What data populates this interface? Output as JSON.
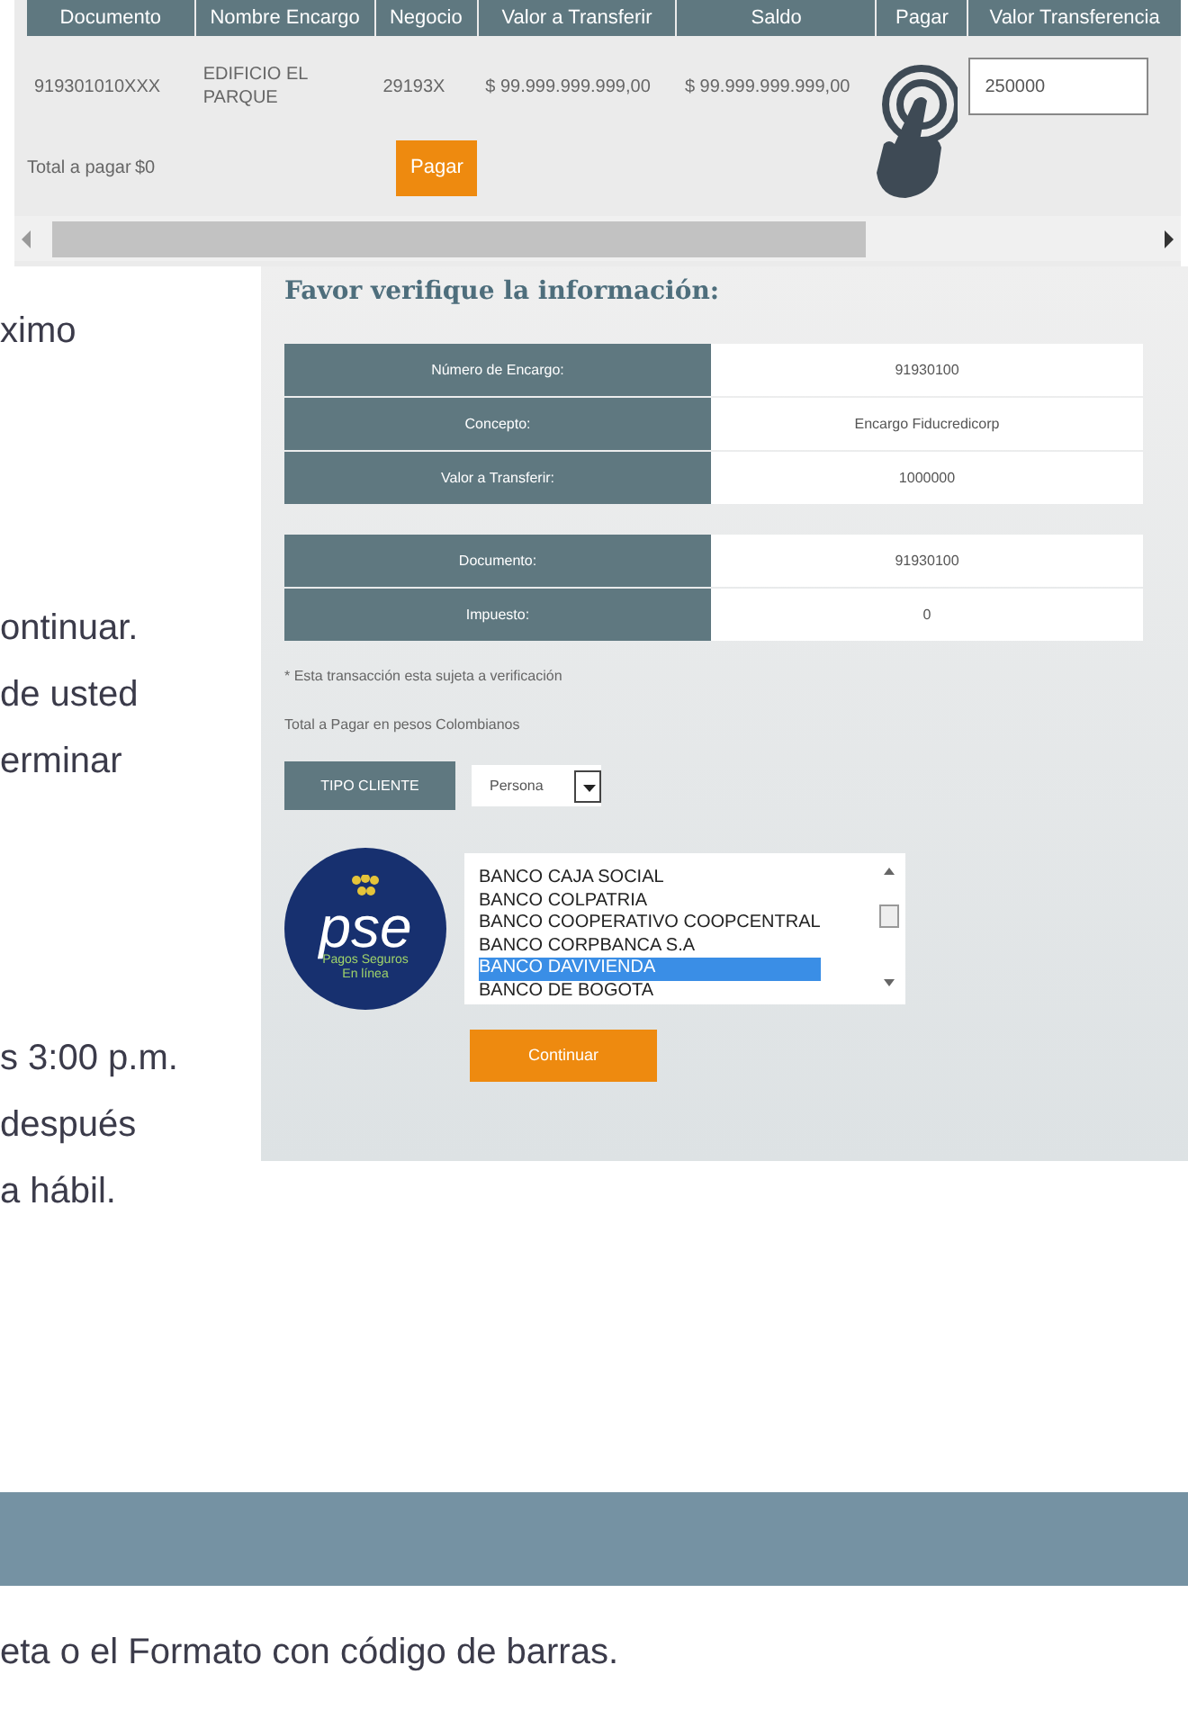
{
  "payment_table": {
    "columns": [
      "Documento",
      "Nombre Encargo",
      "Negocio",
      "Valor a Transferir",
      "Saldo",
      "Pagar",
      "Valor Transferencia"
    ],
    "row": {
      "cells": [
        "919301010XXX",
        "EDIFICIO EL PARQUE",
        "29193X",
        "$ 99.999.999.999,00",
        "$ 99.999.999.999,00"
      ],
      "transfer_value": "250000"
    },
    "total_label": "Total a pagar",
    "total_value": "$0",
    "pay_button": "Pagar"
  },
  "article_paragraphs": [
    [
      "ximo"
    ],
    [
      "ontinuar.",
      "de usted",
      "erminar"
    ],
    [
      "s 3:00 p.m.",
      "después",
      "a hábil."
    ]
  ],
  "verification": {
    "title": "Favor verifique la información:",
    "groups": [
      [
        {
          "label": "Número de Encargo:",
          "value": "91930100"
        },
        {
          "label": "Concepto:",
          "value": "Encargo Fiducredicorp"
        },
        {
          "label": "Valor a Transferir:",
          "value": "1000000"
        }
      ],
      [
        {
          "label": "Documento:",
          "value": "91930100"
        },
        {
          "label": "Impuesto:",
          "value": "0"
        }
      ]
    ],
    "note": "* Esta transacción esta sujeta a verificación",
    "total_text": "Total a Pagar en pesos Colombianos",
    "client_type": {
      "label": "TIPO CLIENTE",
      "value": "Persona"
    },
    "logo": {
      "wordmark": "pse",
      "tagline": [
        "Pagos Seguros",
        "En línea"
      ]
    },
    "banks": [
      {
        "name": "BANCO CAJA SOCIAL",
        "selected": false
      },
      {
        "name": "BANCO COLPATRIA",
        "selected": false
      },
      {
        "name": "BANCO COOPERATIVO COOPCENTRAL",
        "selected": false
      },
      {
        "name": "BANCO CORPBANCA S.A",
        "selected": false
      },
      {
        "name": "BANCO DAVIVIENDA",
        "selected": true
      },
      {
        "name": "BANCO DE BOGOTA",
        "selected": false
      }
    ],
    "continue_button": "Continuar"
  },
  "body_text": "eta o el Formato con código de barras."
}
